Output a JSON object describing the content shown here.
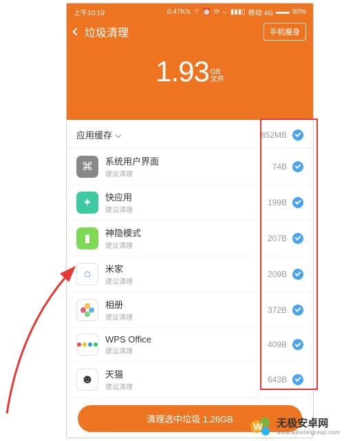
{
  "status": {
    "time": "上午10:19",
    "speed": "0.47K/s",
    "carrier": "移动 4G",
    "battery": "90%"
  },
  "header": {
    "title": "垃圾清理",
    "slim_button": "手机瘦身",
    "summary_value": "1.93",
    "summary_unit": "GB",
    "summary_sub": "文件"
  },
  "category": {
    "label": "应用缓存",
    "size": "852MB"
  },
  "apps": [
    {
      "name": "系统用户界面",
      "sub": "建议清理",
      "size": "74B",
      "iconClass": "icon-sys",
      "glyph": "⌘"
    },
    {
      "name": "快应用",
      "sub": "建议清理",
      "size": "199B",
      "iconClass": "icon-kuai",
      "glyph": "✦"
    },
    {
      "name": "神隐模式",
      "sub": "建议清理",
      "size": "207B",
      "iconClass": "icon-shen",
      "glyph": "▮"
    },
    {
      "name": "米家",
      "sub": "建议清理",
      "size": "209B",
      "iconClass": "icon-mijia",
      "glyph": "⌂"
    },
    {
      "name": "相册",
      "sub": "建议清理",
      "size": "372B",
      "iconClass": "icon-photo",
      "glyph": ""
    },
    {
      "name": "WPS Office",
      "sub": "建议清理",
      "size": "409B",
      "iconClass": "icon-wps",
      "glyph": ""
    },
    {
      "name": "天猫",
      "sub": "建议清理",
      "size": "643B",
      "iconClass": "icon-tmall",
      "glyph": "☻"
    }
  ],
  "action": {
    "label": "清理选中垃圾 1.26GB"
  },
  "watermark": {
    "main": "无极安卓网",
    "sub": "www.wjhotelgroup.com"
  }
}
